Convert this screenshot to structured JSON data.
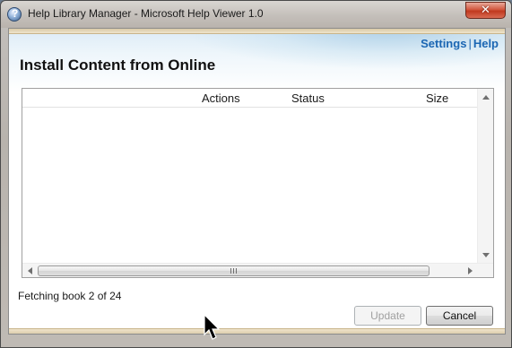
{
  "window": {
    "title": "Help Library Manager - Microsoft Help Viewer 1.0",
    "close_glyph": "✕"
  },
  "header_links": {
    "settings": "Settings",
    "separator": "|",
    "help": "Help"
  },
  "page_title": "Install Content from Online",
  "list": {
    "columns": [
      "Actions",
      "Status",
      "Size"
    ],
    "rows": [],
    "scroll_grip": "|||"
  },
  "status": {
    "text": "Fetching book 2 of 24"
  },
  "buttons": {
    "update": "Update",
    "cancel": "Cancel"
  },
  "icons": {
    "app": "help-viewer-icon",
    "cursor": "arrow-cursor-icon"
  },
  "colors": {
    "link": "#1b66b3",
    "close": "#c0391f"
  }
}
